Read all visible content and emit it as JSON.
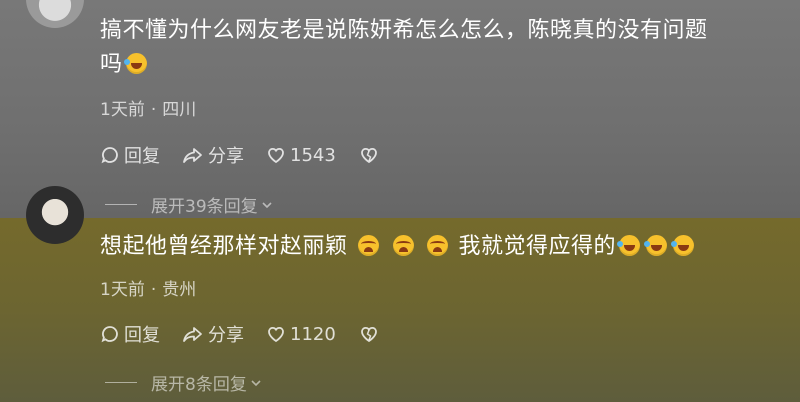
{
  "comments": [
    {
      "text_line1": "搞不懂为什么网友老是说陈妍希怎么怎么，陈晓真的没有问题",
      "text_line2": "吗",
      "time": "1天前",
      "location": "四川",
      "reply_label": "回复",
      "share_label": "分享",
      "like_count": "1543",
      "expand_label": "展开39条回复"
    },
    {
      "text_part1": "想起他曾经那样对赵丽颖",
      "text_part2": "我就觉得应得的",
      "time": "1天前",
      "location": "贵州",
      "reply_label": "回复",
      "share_label": "分享",
      "like_count": "1120",
      "expand_label": "展开8条回复"
    }
  ],
  "separator": "·",
  "emoji_names": [
    "laugh-cry-emoji",
    "pleading-emoji"
  ],
  "colors": {
    "top_band": "#737373",
    "bottom_band": "#6c6531"
  }
}
